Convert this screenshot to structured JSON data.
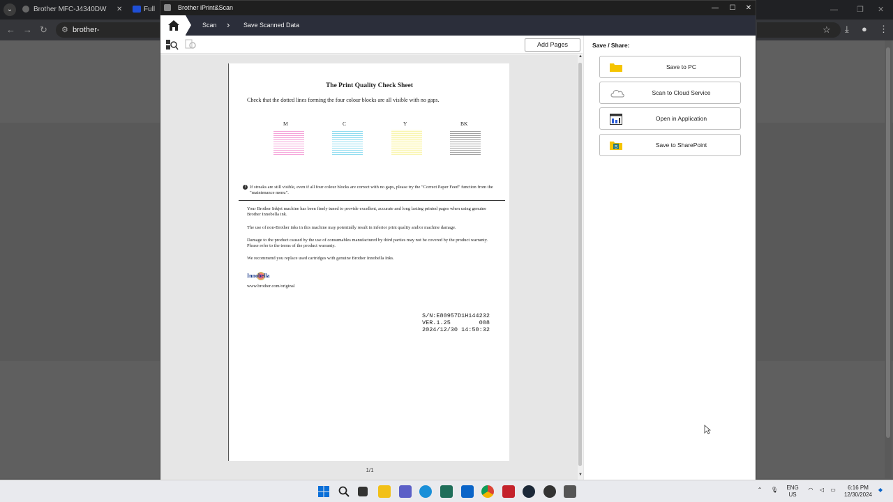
{
  "browser": {
    "tab1_title": "Brother MFC-J4340DW",
    "tab2_title": "Full Sc",
    "address": "brother-usa.com/installationc"
  },
  "app": {
    "window_title": "Brother iPrint&Scan",
    "breadcrumb": [
      "Scan",
      "Save Scanned Data"
    ],
    "add_pages": "Add Pages",
    "page_indicator": "1/1"
  },
  "document": {
    "title": "The Print Quality Check Sheet",
    "subtitle": "Check that the dotted lines forming the four colour blocks are all visible with no gaps.",
    "blocks": [
      "M",
      "C",
      "Y",
      "BK"
    ],
    "info_note": "If streaks are still visible, even if all four colour blocks are correct with no gaps, please try the \"Correct Paper Feed\" function from the \"maintenance menu\".",
    "paragraphs": [
      "Your Brother Inkjet machine has been finely tuned to provide excellent, accurate and long lasting printed pages when using genuine Brother Innobella ink.",
      "The use of non-Brother inks in this machine may potentially result in inferior print quality and/or machine damage.",
      "Damage to the product caused by the use of consumables manufactured by third parties may not be covered by the product warranty. Please refer to the terms of the product warranty.",
      "We recommend you replace used cartridges with genuine Brother Innobella Inks."
    ],
    "logo_text": "Innobella",
    "url": "www.brother.com/original",
    "serial": "S/N:E80957D1H144232",
    "version": "VER.1.25        008",
    "datetime": "2024/12/30 14:50:32"
  },
  "share": {
    "title": "Save / Share:",
    "options": [
      "Save to PC",
      "Scan to Cloud Service",
      "Open in Application",
      "Save to SharePoint"
    ]
  },
  "taskbar": {
    "lang1": "ENG",
    "lang2": "US",
    "time": "6:16 PM",
    "date": "12/30/2024"
  },
  "colors": {
    "navbar": "#2b2e3a",
    "folder": "#f5c400",
    "magenta_block": "#f5a0d8",
    "cyan_block": "#8fdcf0",
    "yellow_block": "#f9f5b0"
  }
}
